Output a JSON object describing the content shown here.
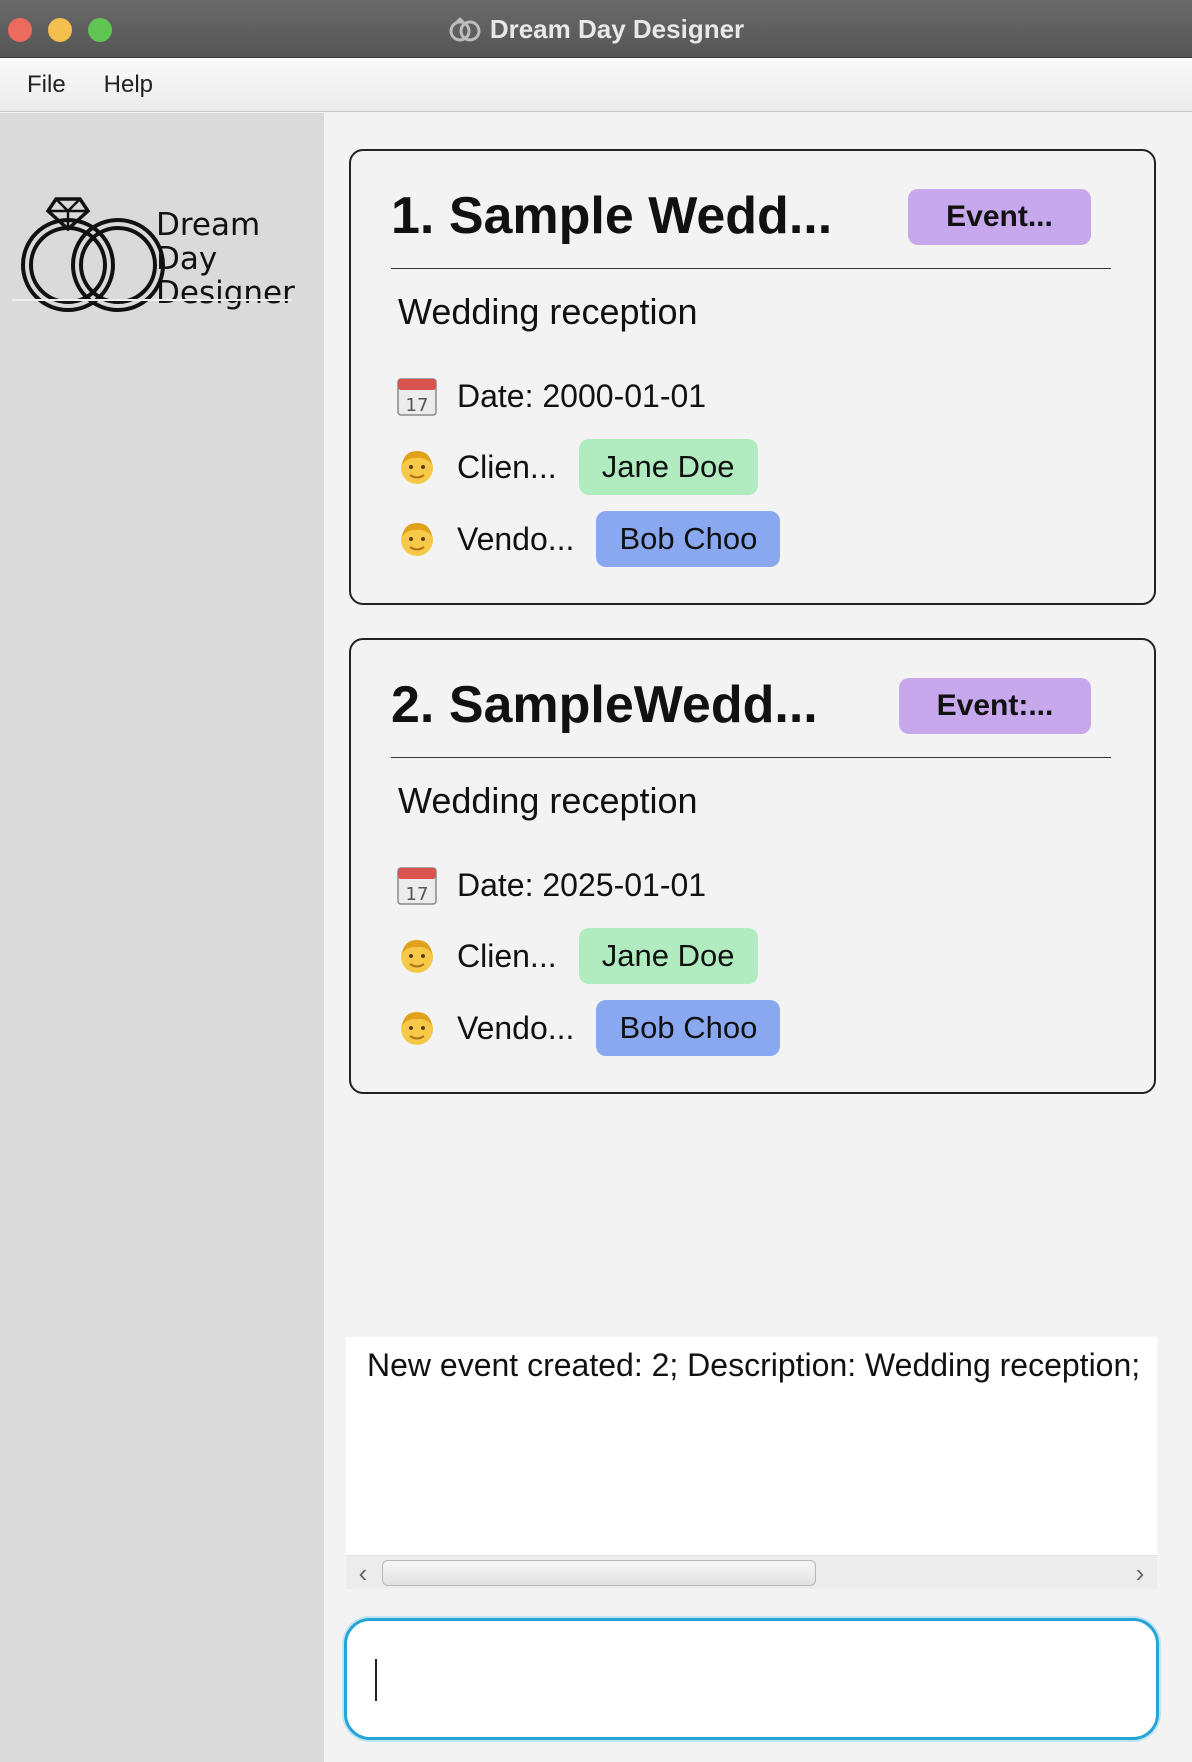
{
  "window": {
    "title": "Dream Day Designer",
    "title_icon": "rings-icon"
  },
  "menu": [
    {
      "label": "File"
    },
    {
      "label": "Help"
    }
  ],
  "logo": {
    "line1": "Dream",
    "line2": "Day",
    "line3": "Designer",
    "icon": "rings-with-diamond-icon"
  },
  "events": [
    {
      "title": "1. Sample Wedd...",
      "tag": "Event...",
      "description": "Wedding reception",
      "date": "Date: 2000-01-01",
      "client_label": "Clien...",
      "client": "Jane Doe",
      "vendor_label": "Vendo...",
      "vendor": "Bob Choo"
    },
    {
      "title": "2. SampleWedd...",
      "tag": "Event:...",
      "description": "Wedding reception",
      "date": "Date: 2025-01-01",
      "client_label": "Clien...",
      "client": "Jane Doe",
      "vendor_label": "Vendo...",
      "vendor": "Bob Choo"
    }
  ],
  "result": {
    "message": "New event created: 2; Description: Wedding reception;"
  },
  "command": {
    "value": ""
  },
  "colors": {
    "event_tag": "#c7a8ec",
    "client_chip": "#b1ecc1",
    "vendor_chip": "#89a8ef",
    "command_focus": "#27a4d6"
  }
}
